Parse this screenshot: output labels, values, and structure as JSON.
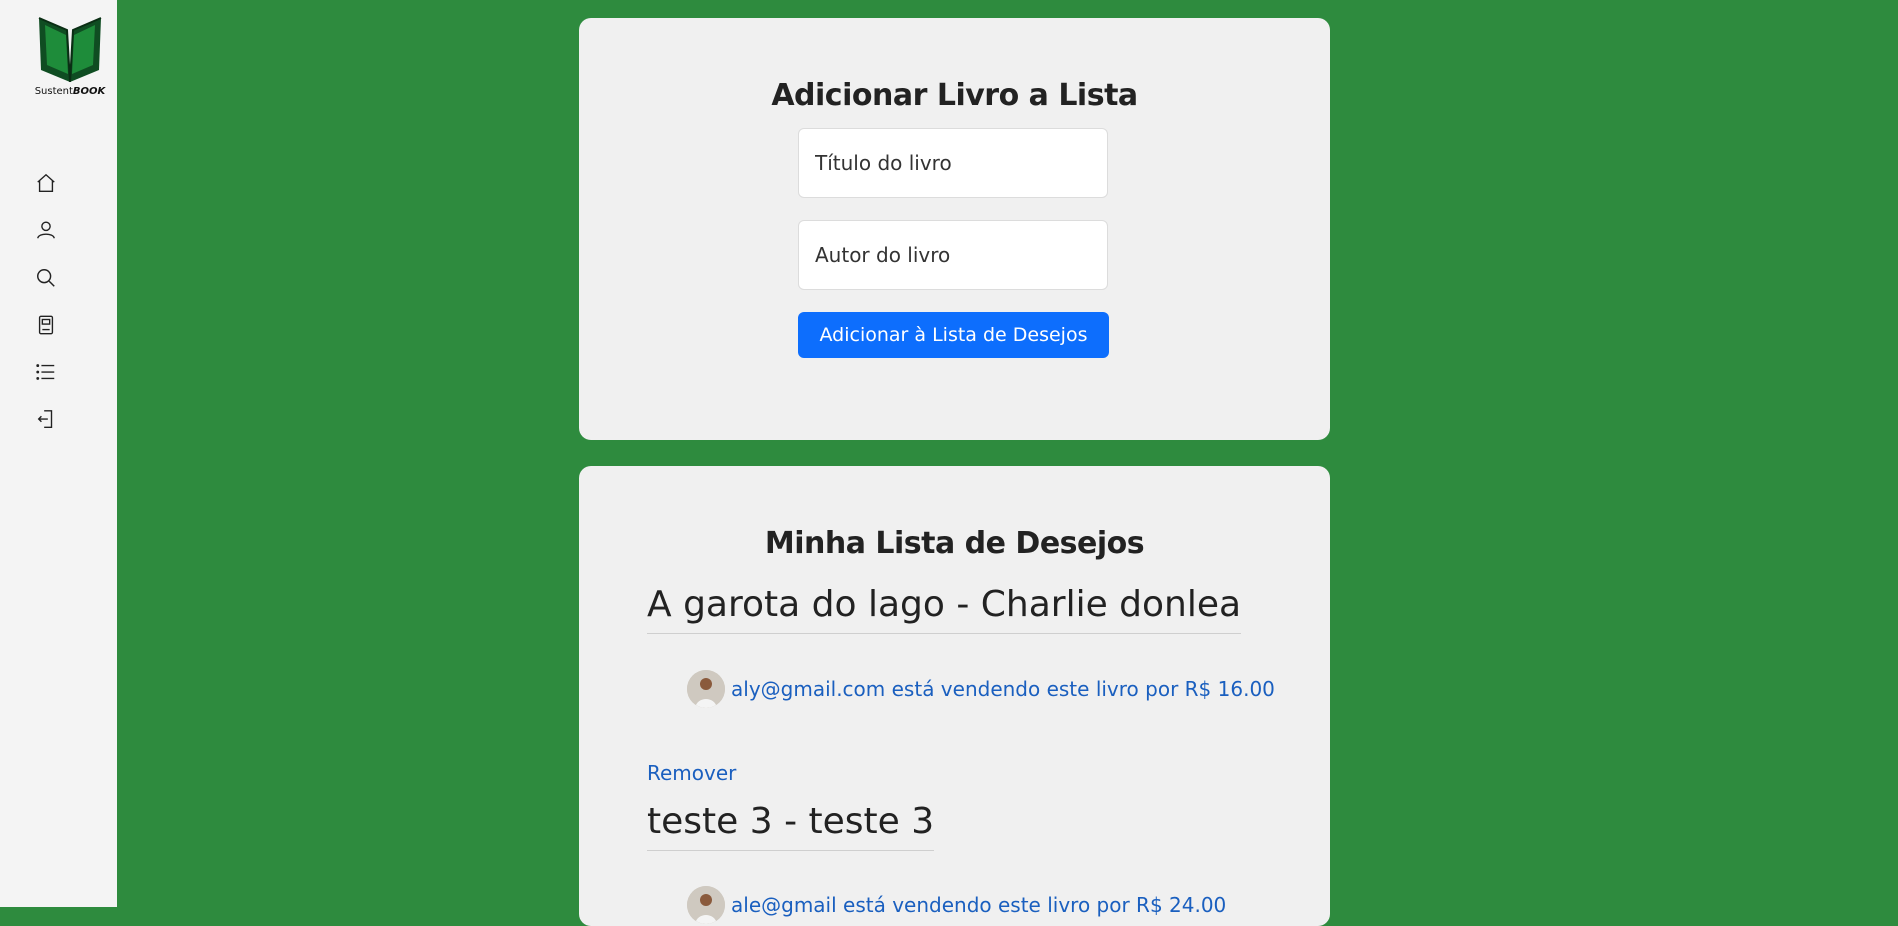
{
  "brand": {
    "name_light": "Sustent",
    "name_bold": "BOOK"
  },
  "colors": {
    "background": "#2e8b3e",
    "accent": "#0d6efd",
    "link": "#1a5fbf",
    "sidebar": "#f4f4f4"
  },
  "sidebar": {
    "items": [
      {
        "icon": "home-icon"
      },
      {
        "icon": "user-icon"
      },
      {
        "icon": "search-icon"
      },
      {
        "icon": "book-icon"
      },
      {
        "icon": "list-icon"
      },
      {
        "icon": "logout-icon"
      }
    ]
  },
  "add_form": {
    "title": "Adicionar Livro a Lista",
    "title_placeholder": "Título do livro",
    "author_placeholder": "Autor do livro",
    "submit_label": "Adicionar à Lista de Desejos"
  },
  "wishlist": {
    "title": "Minha Lista de Desejos",
    "items": [
      {
        "book": "A garota do lago - Charlie donlea",
        "seller": "aly@gmail.com está vendendo este livro por R$ 16.00",
        "remove_label": "Remover"
      },
      {
        "book": "teste 3 - teste 3",
        "seller": "ale@gmail está vendendo este livro por R$ 24.00"
      }
    ]
  }
}
